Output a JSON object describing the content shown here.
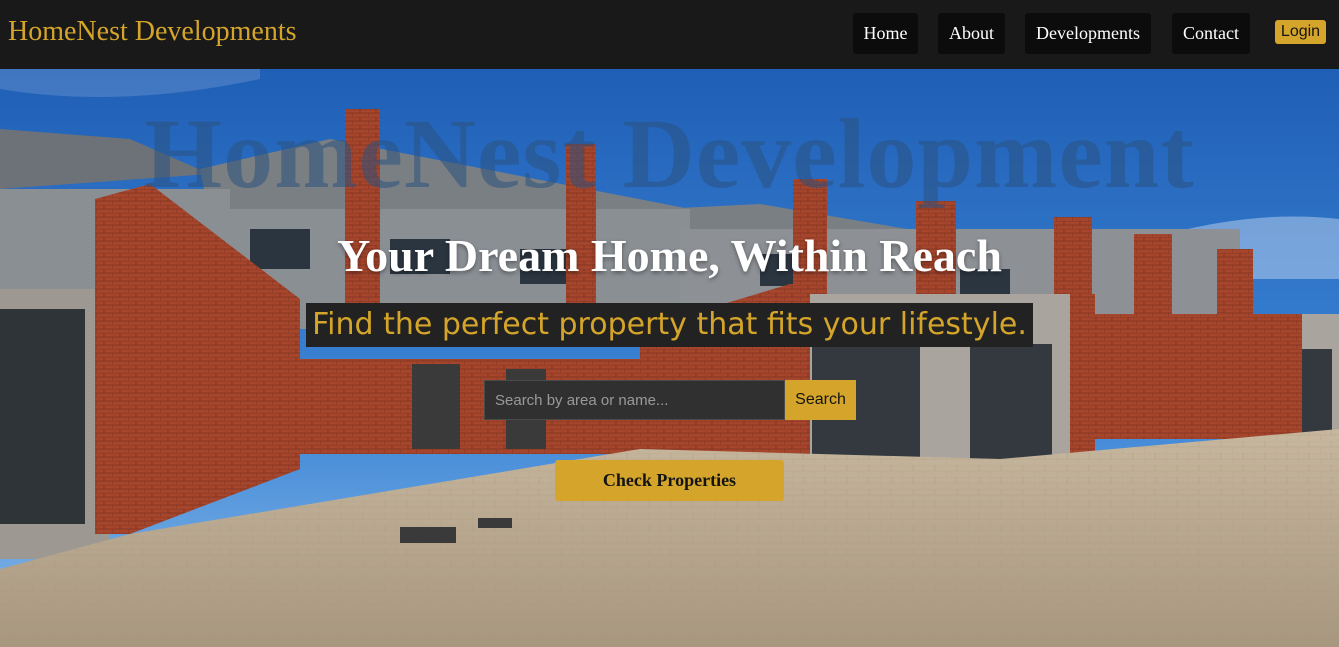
{
  "brand": "HomeNest Developments",
  "nav": {
    "items": [
      "Home",
      "About",
      "Developments",
      "Contact"
    ],
    "login": "Login"
  },
  "hero": {
    "watermark": "HomeNest Development",
    "headline": "Your Dream Home, Within Reach",
    "subheadline": "Find the perfect property that fits your lifestyle.",
    "search_placeholder": "Search by area or name...",
    "search_button": "Search",
    "cta": "Check Properties"
  },
  "colors": {
    "accent": "#d4a52a",
    "navbar": "#191919",
    "nav_button": "#0c0c0c"
  }
}
